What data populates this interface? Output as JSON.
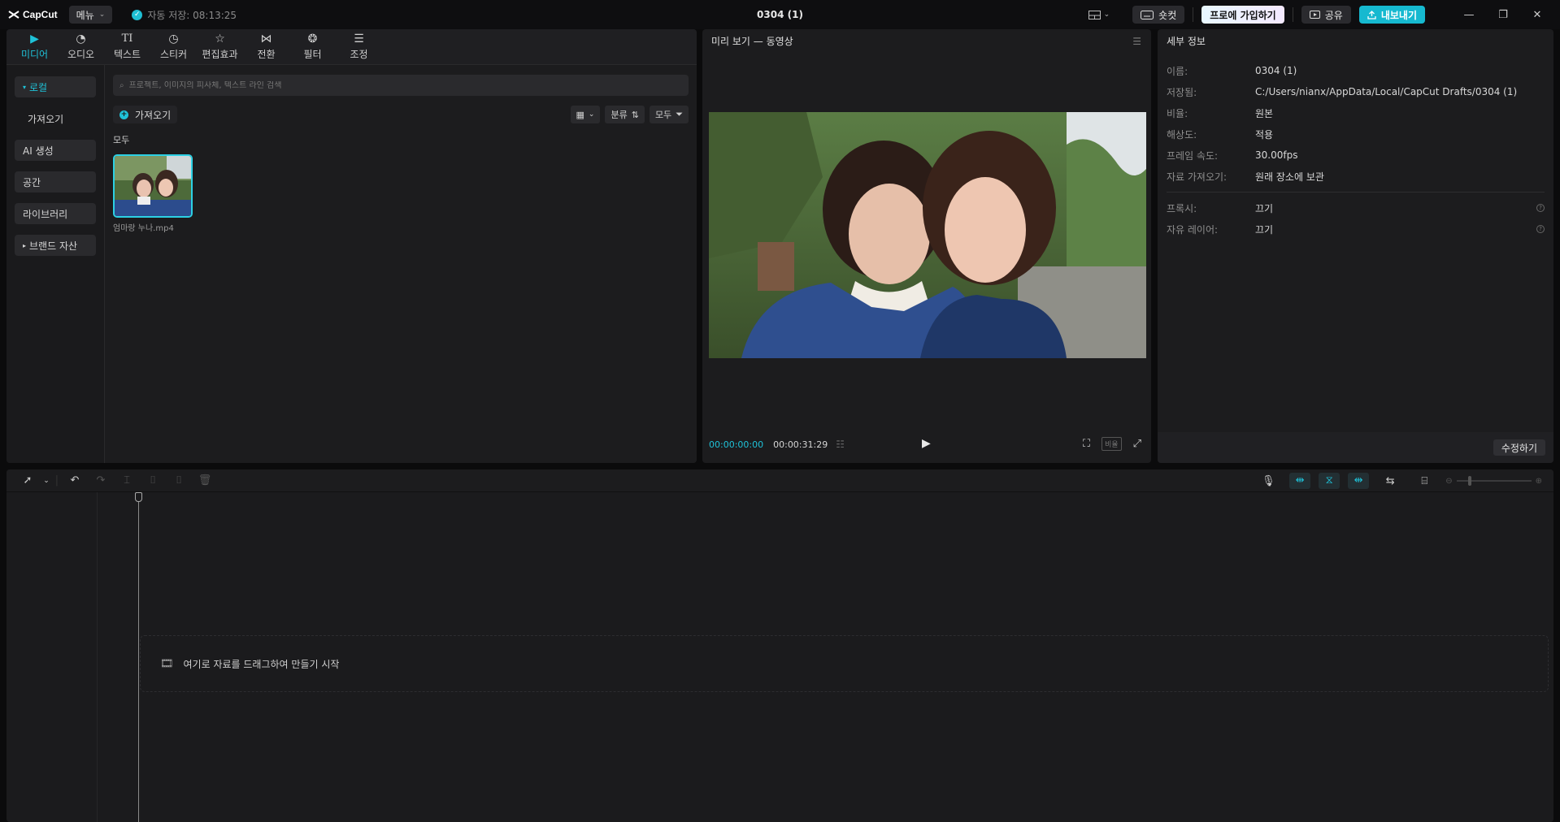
{
  "app": {
    "logo": "CapCut",
    "menu_label": "메뉴",
    "autosave": "자동 저장: 08:13:25",
    "title": "0304 (1)",
    "shortcut_label": "숏컷",
    "pro_label": "프로에 가입하기",
    "share_label": "공유",
    "export_label": "내보내기"
  },
  "media": {
    "tabs": [
      {
        "label": "미디어",
        "icon": "media-icon"
      },
      {
        "label": "오디오",
        "icon": "audio-icon"
      },
      {
        "label": "텍스트",
        "icon": "text-icon"
      },
      {
        "label": "스티커",
        "icon": "sticker-icon"
      },
      {
        "label": "편집효과",
        "icon": "effects-icon"
      },
      {
        "label": "전환",
        "icon": "transition-icon"
      },
      {
        "label": "필터",
        "icon": "filter-icon"
      },
      {
        "label": "조정",
        "icon": "adjust-icon"
      }
    ],
    "side": [
      "로컬",
      "가져오기",
      "AI 생성",
      "공간",
      "라이브러리",
      "브랜드 자산"
    ],
    "search_placeholder": "프로젝트, 이미지의 피사체, 텍스트 라인 검색",
    "import_label": "가져오기",
    "sort_label": "분류",
    "filter_label": "모두",
    "section_label": "모두",
    "clip_name": "엄마랑 누나.mp4"
  },
  "preview": {
    "title": "미리 보기 — 동영상",
    "time_current": "00:00:00:00",
    "time_total": "00:00:31:29",
    "ratio_label": "비율"
  },
  "detail": {
    "title": "세부 정보",
    "rows": [
      {
        "label": "이름:",
        "value": "0304 (1)"
      },
      {
        "label": "저장됨:",
        "value": "C:/Users/nianx/AppData/Local/CapCut Drafts/0304 (1)"
      },
      {
        "label": "비율:",
        "value": "원본"
      },
      {
        "label": "해상도:",
        "value": "적용"
      },
      {
        "label": "프레임 속도:",
        "value": "30.00fps"
      },
      {
        "label": "자료 가져오기:",
        "value": "원래 장소에 보관"
      }
    ],
    "rows2": [
      {
        "label": "프록시:",
        "value": "끄기"
      },
      {
        "label": "자유 레이어:",
        "value": "끄기"
      }
    ],
    "modify_label": "수정하기"
  },
  "timeline": {
    "drop_hint": "여기로 자료를 드래그하여 만들기 시작"
  }
}
